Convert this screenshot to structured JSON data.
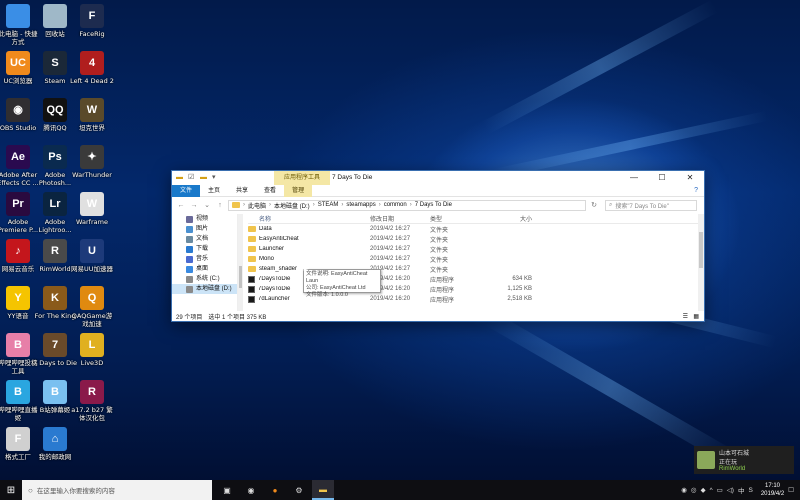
{
  "desktop": {
    "icons": [
      {
        "label": "此电脑 - 快捷方式",
        "glyph": "",
        "color": "#3a8ee6"
      },
      {
        "label": "回收站",
        "glyph": "",
        "color": "#9fb8c8"
      },
      {
        "label": "FaceRig",
        "glyph": "F",
        "color": "#1d2b4f"
      },
      {
        "label": "UC浏览器",
        "glyph": "UC",
        "color": "#f08a1c"
      },
      {
        "label": "Steam",
        "glyph": "S",
        "color": "#1b2838"
      },
      {
        "label": "Left 4 Dead 2",
        "glyph": "4",
        "color": "#b01e1e"
      },
      {
        "label": "OBS Studio",
        "glyph": "◉",
        "color": "#302e31"
      },
      {
        "label": "腾讯QQ",
        "glyph": "QQ",
        "color": "#111111"
      },
      {
        "label": "坦克世界",
        "glyph": "W",
        "color": "#5a4a2a"
      },
      {
        "label": "Adobe After Effects CC ...",
        "glyph": "Ae",
        "color": "#2a0a4f"
      },
      {
        "label": "Adobe Photosh...",
        "glyph": "Ps",
        "color": "#0a2a4f"
      },
      {
        "label": "WarThunder",
        "glyph": "✦",
        "color": "#3a3a3a"
      },
      {
        "label": "Adobe Premiere P...",
        "glyph": "Pr",
        "color": "#2a0a3f"
      },
      {
        "label": "Adobe Lightroo...",
        "glyph": "Lr",
        "color": "#0a2440"
      },
      {
        "label": "Warframe",
        "glyph": "W",
        "color": "#e0e0e0"
      },
      {
        "label": "网易云音乐",
        "glyph": "♪",
        "color": "#c4161c"
      },
      {
        "label": "RimWorld",
        "glyph": "R",
        "color": "#4a4a4a"
      },
      {
        "label": "网易UU加速器",
        "glyph": "U",
        "color": "#1d3a7a"
      },
      {
        "label": "YY语音",
        "glyph": "Y",
        "color": "#f5c400"
      },
      {
        "label": "For The King",
        "glyph": "K",
        "color": "#8a5a1a"
      },
      {
        "label": "QAQGame游戏加速",
        "glyph": "Q",
        "color": "#e08a10"
      },
      {
        "label": "哔哩哔哩投稿工具",
        "glyph": "B",
        "color": "#e77fa8"
      },
      {
        "label": "7 Days to Die",
        "glyph": "7",
        "color": "#6a4a2a"
      },
      {
        "label": "Live3D",
        "glyph": "L",
        "color": "#e0b020"
      },
      {
        "label": "哔哩哔哩直播姬",
        "glyph": "B",
        "color": "#2aa6e0"
      },
      {
        "label": "B站弹幕姬",
        "glyph": "B",
        "color": "#7ac0f0"
      },
      {
        "label": "a17.2 b27 繁体汉化包",
        "glyph": "R",
        "color": "#8a1a4a"
      },
      {
        "label": "格式工厂",
        "glyph": "F",
        "color": "#d0d0d0"
      },
      {
        "label": "我的邮政网",
        "glyph": "⌂",
        "color": "#2a7ad0"
      }
    ]
  },
  "window": {
    "context_tab": "应用程序工具",
    "title": "7 Days To Die",
    "controls": {
      "minimize": "—",
      "maximize": "☐",
      "close": "✕"
    },
    "ribbon": {
      "file": "文件",
      "home": "主页",
      "share": "共享",
      "view": "查看",
      "manage": "管理",
      "help": "?"
    },
    "address": {
      "crumbs": [
        "此电脑",
        "本地磁盘 (D:)",
        "STEAM",
        "steamapps",
        "common",
        "7 Days To Die"
      ],
      "search_placeholder": "搜索\"7 Days To Die\""
    },
    "nav": [
      {
        "label": "视频",
        "color": "#6a6a9a"
      },
      {
        "label": "图片",
        "color": "#4a90d0"
      },
      {
        "label": "文档",
        "color": "#6a8aa0"
      },
      {
        "label": "下载",
        "color": "#2a7ad0"
      },
      {
        "label": "音乐",
        "color": "#4a6ad0"
      },
      {
        "label": "桌面",
        "color": "#3a8ae0"
      },
      {
        "label": "系统 (C:)",
        "color": "#8a8a8a"
      },
      {
        "label": "本地磁盘 (D:)",
        "color": "#8a8a8a"
      }
    ],
    "columns": {
      "name": "名称",
      "date": "修改日期",
      "type": "类型",
      "size": "大小"
    },
    "files": [
      {
        "name": "Data",
        "date": "2019/4/2 16:27",
        "type": "文件夹",
        "size": "",
        "kind": "folder"
      },
      {
        "name": "EasyAntiCheat",
        "date": "2019/4/2 16:27",
        "type": "文件夹",
        "size": "",
        "kind": "folder"
      },
      {
        "name": "Launcher",
        "date": "2019/4/2 16:27",
        "type": "文件夹",
        "size": "",
        "kind": "folder"
      },
      {
        "name": "Mono",
        "date": "2019/4/2 16:27",
        "type": "文件夹",
        "size": "",
        "kind": "folder"
      },
      {
        "name": "steam_shader",
        "date": "2019/4/2 16:27",
        "type": "文件夹",
        "size": "",
        "kind": "folder"
      },
      {
        "name": "7DaysToDie",
        "date": "2019/4/2 16:20",
        "type": "应用程序",
        "size": "634 KB",
        "kind": "exe"
      },
      {
        "name": "7DaysToDie",
        "date": "2019/4/2 16:20",
        "type": "应用程序",
        "size": "1,125 KB",
        "kind": "exe"
      },
      {
        "name": "7dLauncher",
        "date": "2019/4/2 16:20",
        "type": "应用程序",
        "size": "2,518 KB",
        "kind": "exe"
      }
    ],
    "status": {
      "count": "29 个项目",
      "selected": "选中 1 个项目  375 KB"
    }
  },
  "tooltip": {
    "line1": "文件说明: EasyAntiCheat Laun",
    "line2": "公司: EasyAntiCheat Ltd",
    "line3": "文件版本: 1.0.0.0"
  },
  "notification": {
    "title": "山本可石城",
    "status": "正在玩",
    "game": "RimWorld"
  },
  "taskbar": {
    "search_placeholder": "在这里输入你要搜索的内容",
    "time": "17:10",
    "date": "2019/4/2"
  }
}
